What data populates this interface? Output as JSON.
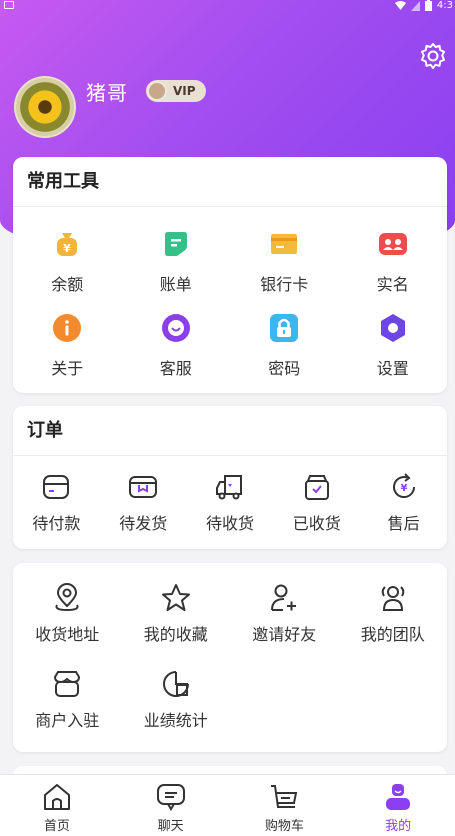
{
  "status": {
    "time": "4:3"
  },
  "profile": {
    "name": "猪哥",
    "vip_label": "VIP",
    "settings_icon": "gear-icon"
  },
  "tools": {
    "title": "常用工具",
    "items": [
      {
        "label": "余额",
        "icon": "money-bag-icon",
        "color": "#f2b53b"
      },
      {
        "label": "账单",
        "icon": "bill-icon",
        "color": "#35c08a"
      },
      {
        "label": "银行卡",
        "icon": "bank-card-icon",
        "color": "#f5b93c"
      },
      {
        "label": "实名",
        "icon": "id-card-icon",
        "color": "#ef4d4d"
      },
      {
        "label": "关于",
        "icon": "info-icon",
        "color": "#f38a2d"
      },
      {
        "label": "客服",
        "icon": "customer-service-icon",
        "color": "#8b3fe8"
      },
      {
        "label": "密码",
        "icon": "lock-icon",
        "color": "#3bb6f0"
      },
      {
        "label": "设置",
        "icon": "settings-icon",
        "color": "#6e45e6"
      }
    ]
  },
  "orders": {
    "title": "订单",
    "items": [
      {
        "label": "待付款",
        "icon": "wallet-icon"
      },
      {
        "label": "待发货",
        "icon": "package-icon"
      },
      {
        "label": "待收货",
        "icon": "truck-icon"
      },
      {
        "label": "已收货",
        "icon": "box-check-icon"
      },
      {
        "label": "售后",
        "icon": "refund-icon"
      }
    ]
  },
  "services": {
    "items": [
      {
        "label": "收货地址",
        "icon": "location-icon"
      },
      {
        "label": "我的收藏",
        "icon": "star-icon"
      },
      {
        "label": "邀请好友",
        "icon": "add-user-icon"
      },
      {
        "label": "我的团队",
        "icon": "team-icon"
      },
      {
        "label": "商户入驻",
        "icon": "shop-icon"
      },
      {
        "label": "业绩统计",
        "icon": "stats-icon"
      }
    ]
  },
  "tabbar": {
    "items": [
      {
        "label": "首页",
        "icon": "home-icon"
      },
      {
        "label": "聊天",
        "icon": "chat-icon"
      },
      {
        "label": "购物车",
        "icon": "cart-icon"
      },
      {
        "label": "我的",
        "icon": "profile-icon",
        "active": true
      }
    ],
    "accent": "#8c3ff0"
  }
}
